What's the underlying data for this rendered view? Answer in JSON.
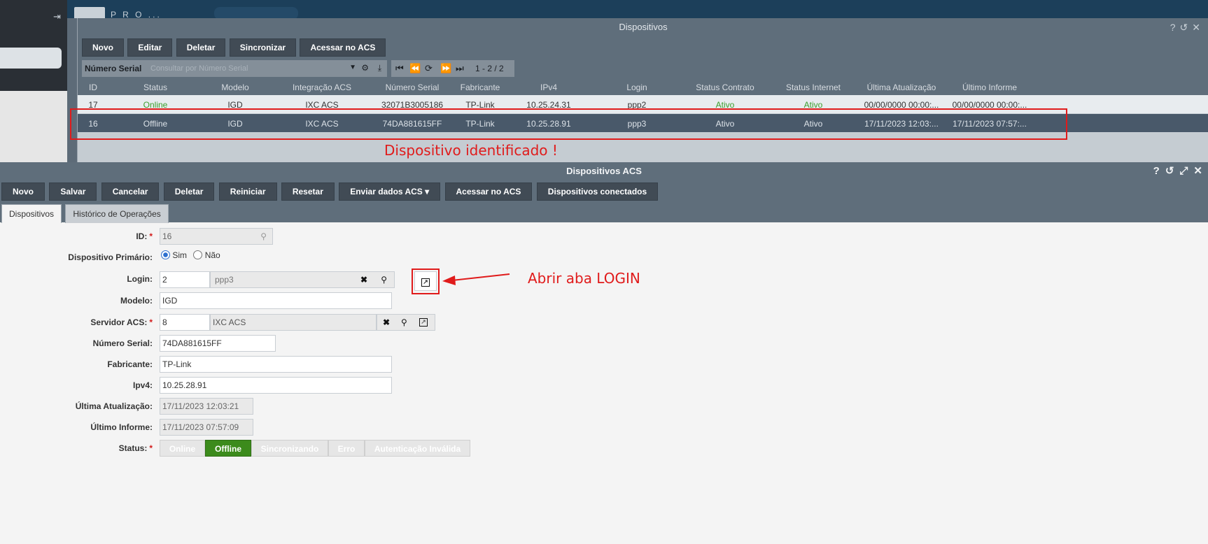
{
  "background": {
    "tab_text": "P R O ..."
  },
  "win1": {
    "title": "Dispositivos",
    "toolbar": [
      "Novo",
      "Editar",
      "Deletar",
      "Sincronizar",
      "Acessar no ACS"
    ],
    "search": {
      "field": "Número Serial",
      "placeholder": "Consultar por Número Serial"
    },
    "pager": "1 - 2 / 2",
    "columns": [
      "ID",
      "Status",
      "Modelo",
      "Integração ACS",
      "Número Serial",
      "Fabricante",
      "IPv4",
      "Login",
      "Status Contrato",
      "Status Internet",
      "Última Atualização",
      "Último Informe"
    ],
    "rows": [
      [
        "17",
        "Online",
        "IGD",
        "IXC ACS",
        "32071B3005186",
        "TP-Link",
        "10.25.24.31",
        "ppp2",
        "Ativo",
        "Ativo",
        "00/00/0000 00:00:...",
        "00/00/0000 00:00:..."
      ],
      [
        "16",
        "Offline",
        "IGD",
        "IXC ACS",
        "74DA881615FF",
        "TP-Link",
        "10.25.28.91",
        "ppp3",
        "Ativo",
        "Ativo",
        "17/11/2023 12:03:...",
        "17/11/2023 07:57:..."
      ]
    ]
  },
  "annotations": {
    "device_found": "Dispositivo identificado !",
    "open_login": "Abrir aba LOGIN"
  },
  "win2": {
    "title": "Dispositivos ACS",
    "toolbar": [
      "Novo",
      "Salvar",
      "Cancelar",
      "Deletar",
      "Reiniciar",
      "Resetar",
      "Enviar dados ACS ▾",
      "Acessar no ACS",
      "Dispositivos conectados"
    ],
    "tabs": [
      "Dispositivos",
      "Histórico de Operações"
    ],
    "form": {
      "id_label": "ID:",
      "id_value": "16",
      "primary_label": "Dispositivo Primário:",
      "primary_yes": "Sim",
      "primary_no": "Não",
      "login_label": "Login:",
      "login_id": "2",
      "login_name": "ppp3",
      "model_label": "Modelo:",
      "model_value": "IGD",
      "acs_label": "Servidor ACS:",
      "acs_id": "8",
      "acs_name": "IXC ACS",
      "serial_label": "Número Serial:",
      "serial_value": "74DA881615FF",
      "maker_label": "Fabricante:",
      "maker_value": "TP-Link",
      "ipv4_label": "Ipv4:",
      "ipv4_value": "10.25.28.91",
      "last_update_label": "Última Atualização:",
      "last_update_value": "17/11/2023 12:03:21",
      "last_report_label": "Último Informe:",
      "last_report_value": "17/11/2023 07:57:09",
      "status_label": "Status:",
      "status_options": [
        "Online",
        "Offline",
        "Sincronizando",
        "Erro",
        "Autenticação Inválida"
      ],
      "status_selected": "Offline"
    }
  },
  "colors": {
    "accent_red": "#e01b1b",
    "status_green": "#3c8b1c",
    "header": "#5f6e7b"
  }
}
